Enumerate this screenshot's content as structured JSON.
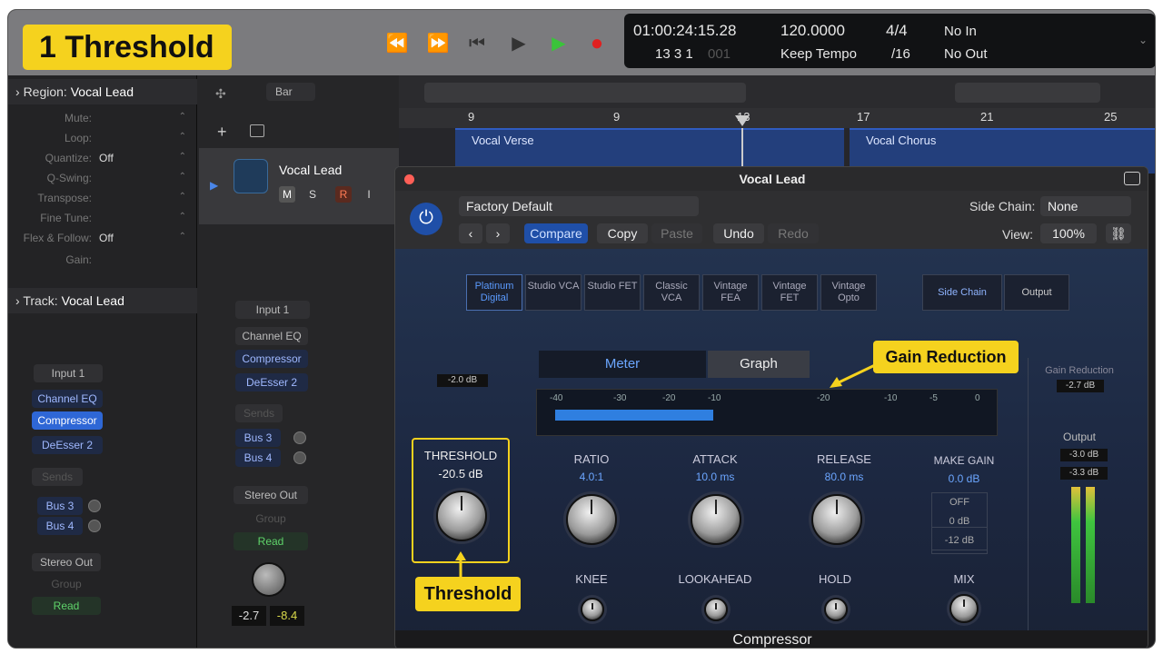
{
  "step_badge": "1 Threshold",
  "transport": {
    "rewind": "⏪",
    "forward": "⏩",
    "to_start": "⏮",
    "play": "▶",
    "play_green": "▶",
    "record": "●"
  },
  "lcd": {
    "time": "01:00:24:15.28",
    "bars": "13 3 1",
    "bars_dim": "001",
    "tempo": "120.0000",
    "tempo_mode": "Keep Tempo",
    "sig_top": "4/4",
    "sig_bottom": "/16",
    "in": "No In",
    "out": "No Out"
  },
  "inspector": {
    "region_header": "Region:",
    "region_name": "Vocal Lead",
    "rows": [
      {
        "label": "Mute:",
        "value": ""
      },
      {
        "label": "Loop:",
        "value": ""
      },
      {
        "label": "Quantize:",
        "value": "Off"
      },
      {
        "label": "Q-Swing:",
        "value": ""
      },
      {
        "label": "Transpose:",
        "value": ""
      },
      {
        "label": "Fine Tune:",
        "value": ""
      },
      {
        "label": "Flex & Follow:",
        "value": "Off"
      },
      {
        "label": "Gain:",
        "value": ""
      }
    ],
    "track_header": "Track:",
    "track_name": "Vocal Lead",
    "input": "Input 1",
    "slots": [
      "Channel EQ",
      "Compressor",
      "DeEsser 2"
    ],
    "sends": "Sends",
    "bus_a": "Bus 3",
    "bus_b": "Bus 4",
    "output": "Stereo Out",
    "group": "Group",
    "automation": "Read"
  },
  "strip": {
    "track_name": "Vocal Lead",
    "m": "M",
    "s": "S",
    "r": "R",
    "i": "I",
    "snap": "Bar",
    "input": "Input 1",
    "slots": [
      "Channel EQ",
      "Compressor",
      "DeEsser 2"
    ],
    "sends": "Sends",
    "bus_a": "Bus 3",
    "bus_b": "Bus 4",
    "output": "Stereo Out",
    "group": "Group",
    "automation": "Read",
    "vol": "-2.7",
    "peak": "-8.4"
  },
  "ruler": {
    "marks": [
      "9",
      "9",
      "13",
      "17",
      "21",
      "25"
    ]
  },
  "regions": {
    "verse": "Vocal Verse",
    "chorus": "Vocal Chorus"
  },
  "plugin": {
    "title": "Vocal Lead",
    "preset": "Factory Default",
    "sidechain_label": "Side Chain:",
    "sidechain_value": "None",
    "compare": "Compare",
    "copy": "Copy",
    "paste": "Paste",
    "undo": "Undo",
    "redo": "Redo",
    "view_label": "View:",
    "view_value": "100%",
    "models": [
      "Platinum Digital",
      "Studio VCA",
      "Studio FET",
      "Classic VCA",
      "Vintage FEA",
      "Vintage FET",
      "Vintage Opto"
    ],
    "side_chain_btn": "Side Chain",
    "output_btn": "Output",
    "meter_tab": "Meter",
    "graph_tab": "Graph",
    "meter_scale": [
      "-40",
      "-30",
      "-20",
      "-10",
      "",
      "-20",
      "-10",
      "-5",
      "0"
    ],
    "input_level": "-2.0 dB",
    "gain_reduction_label": "Gain Reduction",
    "gain_reduction_value": "-2.7 dB",
    "output_label": "Output",
    "output_a": "-3.0 dB",
    "output_b": "-3.3 dB",
    "threshold_label": "THRESHOLD",
    "threshold_value": "-20.5 dB",
    "ratio_label": "RATIO",
    "ratio_value": "4.0:1",
    "attack_label": "ATTACK",
    "attack_value": "10.0 ms",
    "release_label": "RELEASE",
    "release_value": "80.0 ms",
    "makegain_label": "MAKE GAIN",
    "makegain_value": "0.0 dB",
    "limiter": [
      "OFF",
      "0 dB",
      "-12 dB"
    ],
    "knee_label": "KNEE",
    "lookahead_label": "LOOKAHEAD",
    "hold_label": "HOLD",
    "mix_label": "MIX",
    "footer": "Compressor"
  },
  "callouts": {
    "gain_reduction": "Gain Reduction",
    "threshold": "Threshold"
  },
  "colors": {
    "highlight": "#f5d21e",
    "accent_blue": "#2e67d6",
    "meter_blue": "#2f7fe0"
  }
}
